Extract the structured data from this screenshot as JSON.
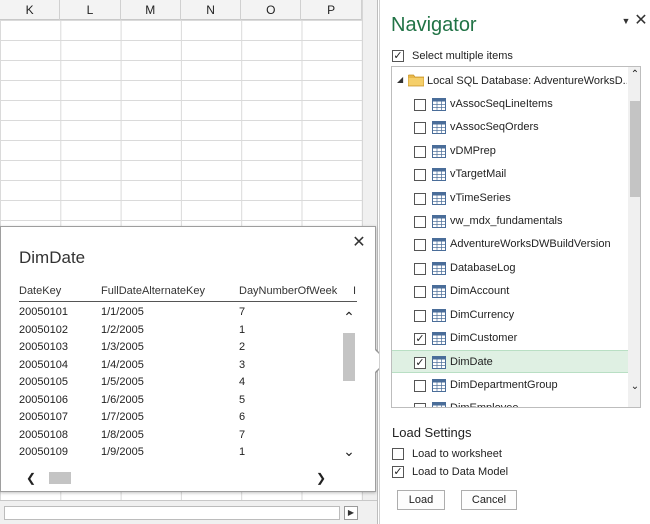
{
  "spreadsheet": {
    "columns": [
      "K",
      "L",
      "M",
      "N",
      "O",
      "P"
    ]
  },
  "preview": {
    "title": "DimDate",
    "headers": [
      "DateKey",
      "FullDateAlternateKey",
      "DayNumberOfWeek",
      "I"
    ],
    "rows": [
      [
        "20050101",
        "1/1/2005",
        "7"
      ],
      [
        "20050102",
        "1/2/2005",
        "1"
      ],
      [
        "20050103",
        "1/3/2005",
        "2"
      ],
      [
        "20050104",
        "1/4/2005",
        "3"
      ],
      [
        "20050105",
        "1/5/2005",
        "4"
      ],
      [
        "20050106",
        "1/6/2005",
        "5"
      ],
      [
        "20050107",
        "1/7/2005",
        "6"
      ],
      [
        "20050108",
        "1/8/2005",
        "7"
      ],
      [
        "20050109",
        "1/9/2005",
        "1"
      ]
    ]
  },
  "navigator": {
    "title": "Navigator",
    "accent_color": "#217346",
    "select_multiple_label": "Select multiple items",
    "select_multiple_checked": true,
    "root_label": "Local SQL Database: AdventureWorksD...",
    "items": [
      {
        "label": "vAssocSeqLineItems",
        "checked": false,
        "selected": false
      },
      {
        "label": "vAssocSeqOrders",
        "checked": false,
        "selected": false
      },
      {
        "label": "vDMPrep",
        "checked": false,
        "selected": false
      },
      {
        "label": "vTargetMail",
        "checked": false,
        "selected": false
      },
      {
        "label": "vTimeSeries",
        "checked": false,
        "selected": false
      },
      {
        "label": "vw_mdx_fundamentals",
        "checked": false,
        "selected": false
      },
      {
        "label": "AdventureWorksDWBuildVersion",
        "checked": false,
        "selected": false
      },
      {
        "label": "DatabaseLog",
        "checked": false,
        "selected": false
      },
      {
        "label": "DimAccount",
        "checked": false,
        "selected": false
      },
      {
        "label": "DimCurrency",
        "checked": false,
        "selected": false
      },
      {
        "label": "DimCustomer",
        "checked": true,
        "selected": false
      },
      {
        "label": "DimDate",
        "checked": true,
        "selected": true
      },
      {
        "label": "DimDepartmentGroup",
        "checked": false,
        "selected": false
      },
      {
        "label": "DimEmployee",
        "checked": false,
        "selected": false
      }
    ],
    "load_settings": {
      "title": "Load Settings",
      "to_worksheet_label": "Load to worksheet",
      "to_worksheet_checked": false,
      "to_data_model_label": "Load to Data Model",
      "to_data_model_checked": true
    },
    "load_label": "Load",
    "cancel_label": "Cancel"
  }
}
